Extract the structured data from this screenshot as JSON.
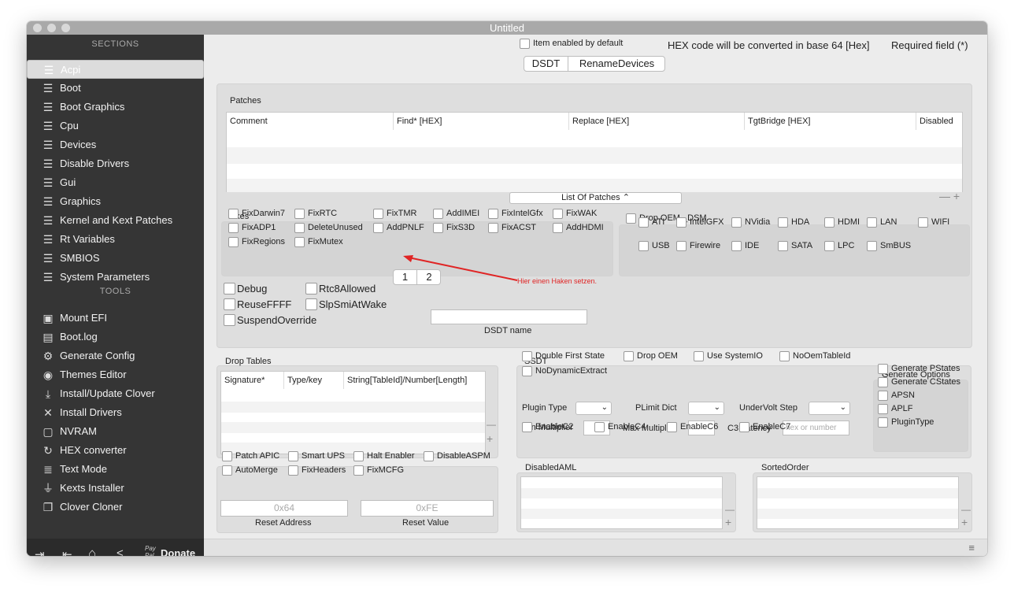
{
  "window": {
    "title": "Untitled"
  },
  "sidebar": {
    "sections_header": "SECTIONS",
    "tools_header": "TOOLS",
    "sections": [
      {
        "label": "Acpi",
        "icon": "list-icon",
        "selected": true
      },
      {
        "label": "Boot",
        "icon": "list-icon"
      },
      {
        "label": "Boot Graphics",
        "icon": "list-icon"
      },
      {
        "label": "Cpu",
        "icon": "list-icon"
      },
      {
        "label": "Devices",
        "icon": "list-icon"
      },
      {
        "label": "Disable Drivers",
        "icon": "list-icon"
      },
      {
        "label": "Gui",
        "icon": "list-icon"
      },
      {
        "label": "Graphics",
        "icon": "list-icon"
      },
      {
        "label": "Kernel and Kext Patches",
        "icon": "list-icon"
      },
      {
        "label": "Rt Variables",
        "icon": "list-icon"
      },
      {
        "label": "SMBIOS",
        "icon": "list-icon"
      },
      {
        "label": "System Parameters",
        "icon": "list-icon"
      }
    ],
    "tools": [
      {
        "label": "Mount EFI",
        "icon": "disk-icon"
      },
      {
        "label": "Boot.log",
        "icon": "log-icon"
      },
      {
        "label": "Generate Config",
        "icon": "gears-icon"
      },
      {
        "label": "Themes Editor",
        "icon": "palette-icon"
      },
      {
        "label": "Install/Update Clover",
        "icon": "download-icon"
      },
      {
        "label": "Install Drivers",
        "icon": "tools-icon"
      },
      {
        "label": "NVRAM",
        "icon": "chip-icon"
      },
      {
        "label": "HEX converter",
        "icon": "refresh-icon"
      },
      {
        "label": "Text Mode",
        "icon": "text-icon"
      },
      {
        "label": "Kexts Installer",
        "icon": "plug-icon"
      },
      {
        "label": "Clover Cloner",
        "icon": "clone-icon"
      }
    ],
    "footer": {
      "donate_label": "Donate",
      "paypal_label": "Pay Pal"
    }
  },
  "header": {
    "item_enabled": "Item enabled by default",
    "hex_note": "HEX code will be converted in base 64 [Hex]",
    "required": "Required field (*)",
    "tabs": [
      "DSDT",
      "RenameDevices"
    ]
  },
  "patches": {
    "title": "Patches",
    "columns": [
      "Comment",
      "Find* [HEX]",
      "Replace [HEX]",
      "TgtBridge [HEX]",
      "Disabled"
    ],
    "popup": "List Of Patches"
  },
  "fixes": {
    "title": "Fixes",
    "items": [
      "FixDarwin7",
      "FixRTC",
      "FixTMR",
      "AddIMEI",
      "FixIntelGfx",
      "FixWAK",
      "FixADP1",
      "DeleteUnused",
      "AddPNLF",
      "FixS3D",
      "FixACST",
      "AddHDMI",
      "FixRegions",
      "FixMutex"
    ],
    "pages": [
      "1",
      "2"
    ],
    "annotation": "Hier einen Haken setzen."
  },
  "dropoem": {
    "title": "Drop OEM _DSM",
    "items": [
      "ATI",
      "IntelGFX",
      "NVidia",
      "HDA",
      "HDMI",
      "LAN",
      "WIFI",
      "USB",
      "Firewire",
      "IDE",
      "SATA",
      "LPC",
      "SmBUS"
    ]
  },
  "dsdt_opts": {
    "items": [
      "Debug",
      "Rtc8Allowed",
      "ReuseFFFF",
      "SlpSmiAtWake",
      "SuspendOverride"
    ],
    "name_label": "DSDT name"
  },
  "drop_tables": {
    "title": "Drop Tables",
    "columns": [
      "Signature*",
      "Type/key",
      "String[TableId]/Number[Length]"
    ]
  },
  "ssdt": {
    "title": "SSDT",
    "checks": [
      "Double First State",
      "Drop OEM",
      "Use SystemIO",
      "NoOemTableId",
      "NoDynamicExtract"
    ],
    "plugin_type": "Plugin Type",
    "plimit": "PLimit Dict",
    "undervolt": "UnderVolt Step",
    "min_mult": "Min Multiplier",
    "max_mult": "Max Multiplier",
    "c3": "C3 Latency",
    "c3_placeholder": "hex or number",
    "enable": [
      "EnableC2",
      "EnableC4",
      "EnableC6",
      "EnableC7"
    ],
    "gen_title": "Generate Options",
    "gen": [
      "Generate PStates",
      "Generate CStates",
      "APSN",
      "APLF",
      "PluginType"
    ]
  },
  "misc": {
    "items": [
      "Patch APIC",
      "Smart UPS",
      "Halt Enabler",
      "DisableASPM",
      "AutoMerge",
      "FixHeaders",
      "FixMCFG"
    ],
    "reset_address_value": "0x64",
    "reset_value_value": "0xFE",
    "reset_address": "Reset Address",
    "reset_value": "Reset Value"
  },
  "disabled_aml": {
    "title": "DisabledAML"
  },
  "sorted_order": {
    "title": "SortedOrder"
  },
  "colors": {
    "sidebar": "#353535",
    "accent": "#e02424"
  }
}
